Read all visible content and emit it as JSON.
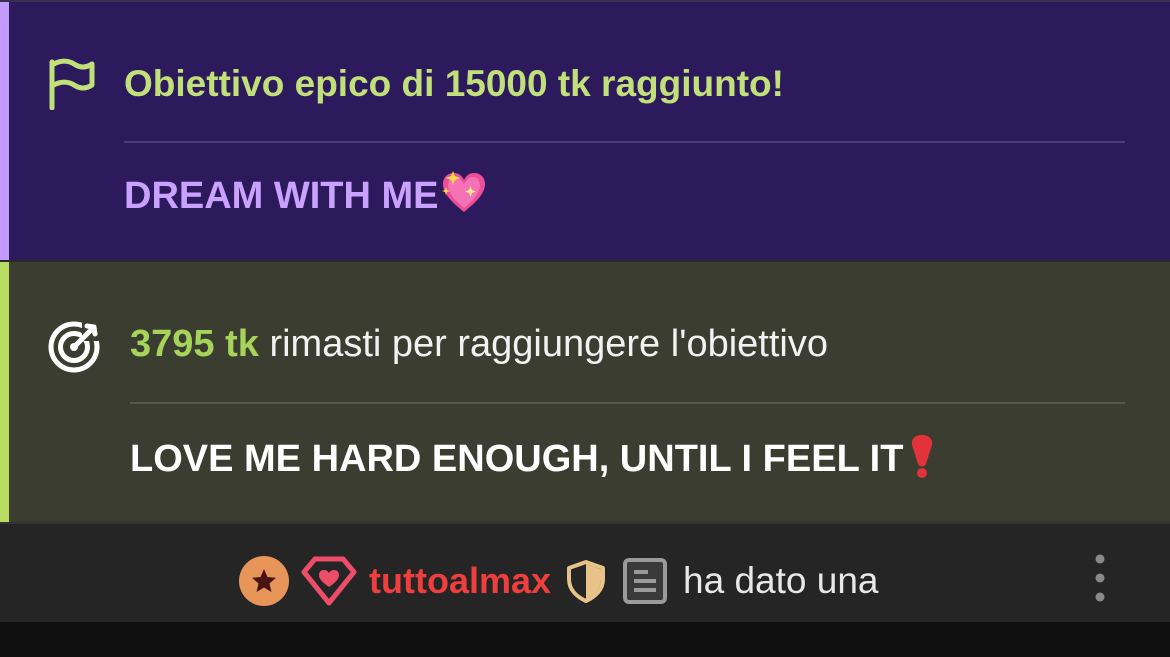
{
  "epic_goal": {
    "title": "Obiettivo epico di 15000 tk raggiunto!",
    "message": "DREAM WITH ME",
    "message_emoji": "sparkling-heart",
    "accent_color": "#c39bff",
    "title_color": "#c2e07a",
    "background": "#2d1a5c",
    "icon": "flag-icon"
  },
  "remaining_goal": {
    "amount": "3795 tk",
    "text": " rimasti per raggiungere l'obiettivo",
    "message": "LOVE ME HARD ENOUGH, UNTIL I FEEL IT",
    "message_emoji": "red-exclamation",
    "accent_color": "#b8dc62",
    "background": "#3a3d30",
    "icon": "target-icon"
  },
  "chat": {
    "username": "tuttoalmax",
    "text": "ha dato una",
    "username_color": "#ef3e3e",
    "badges": [
      "star-badge-icon",
      "diamond-heart-icon",
      "shield-icon",
      "document-icon"
    ],
    "menu_icon": "more-vertical-icon"
  }
}
